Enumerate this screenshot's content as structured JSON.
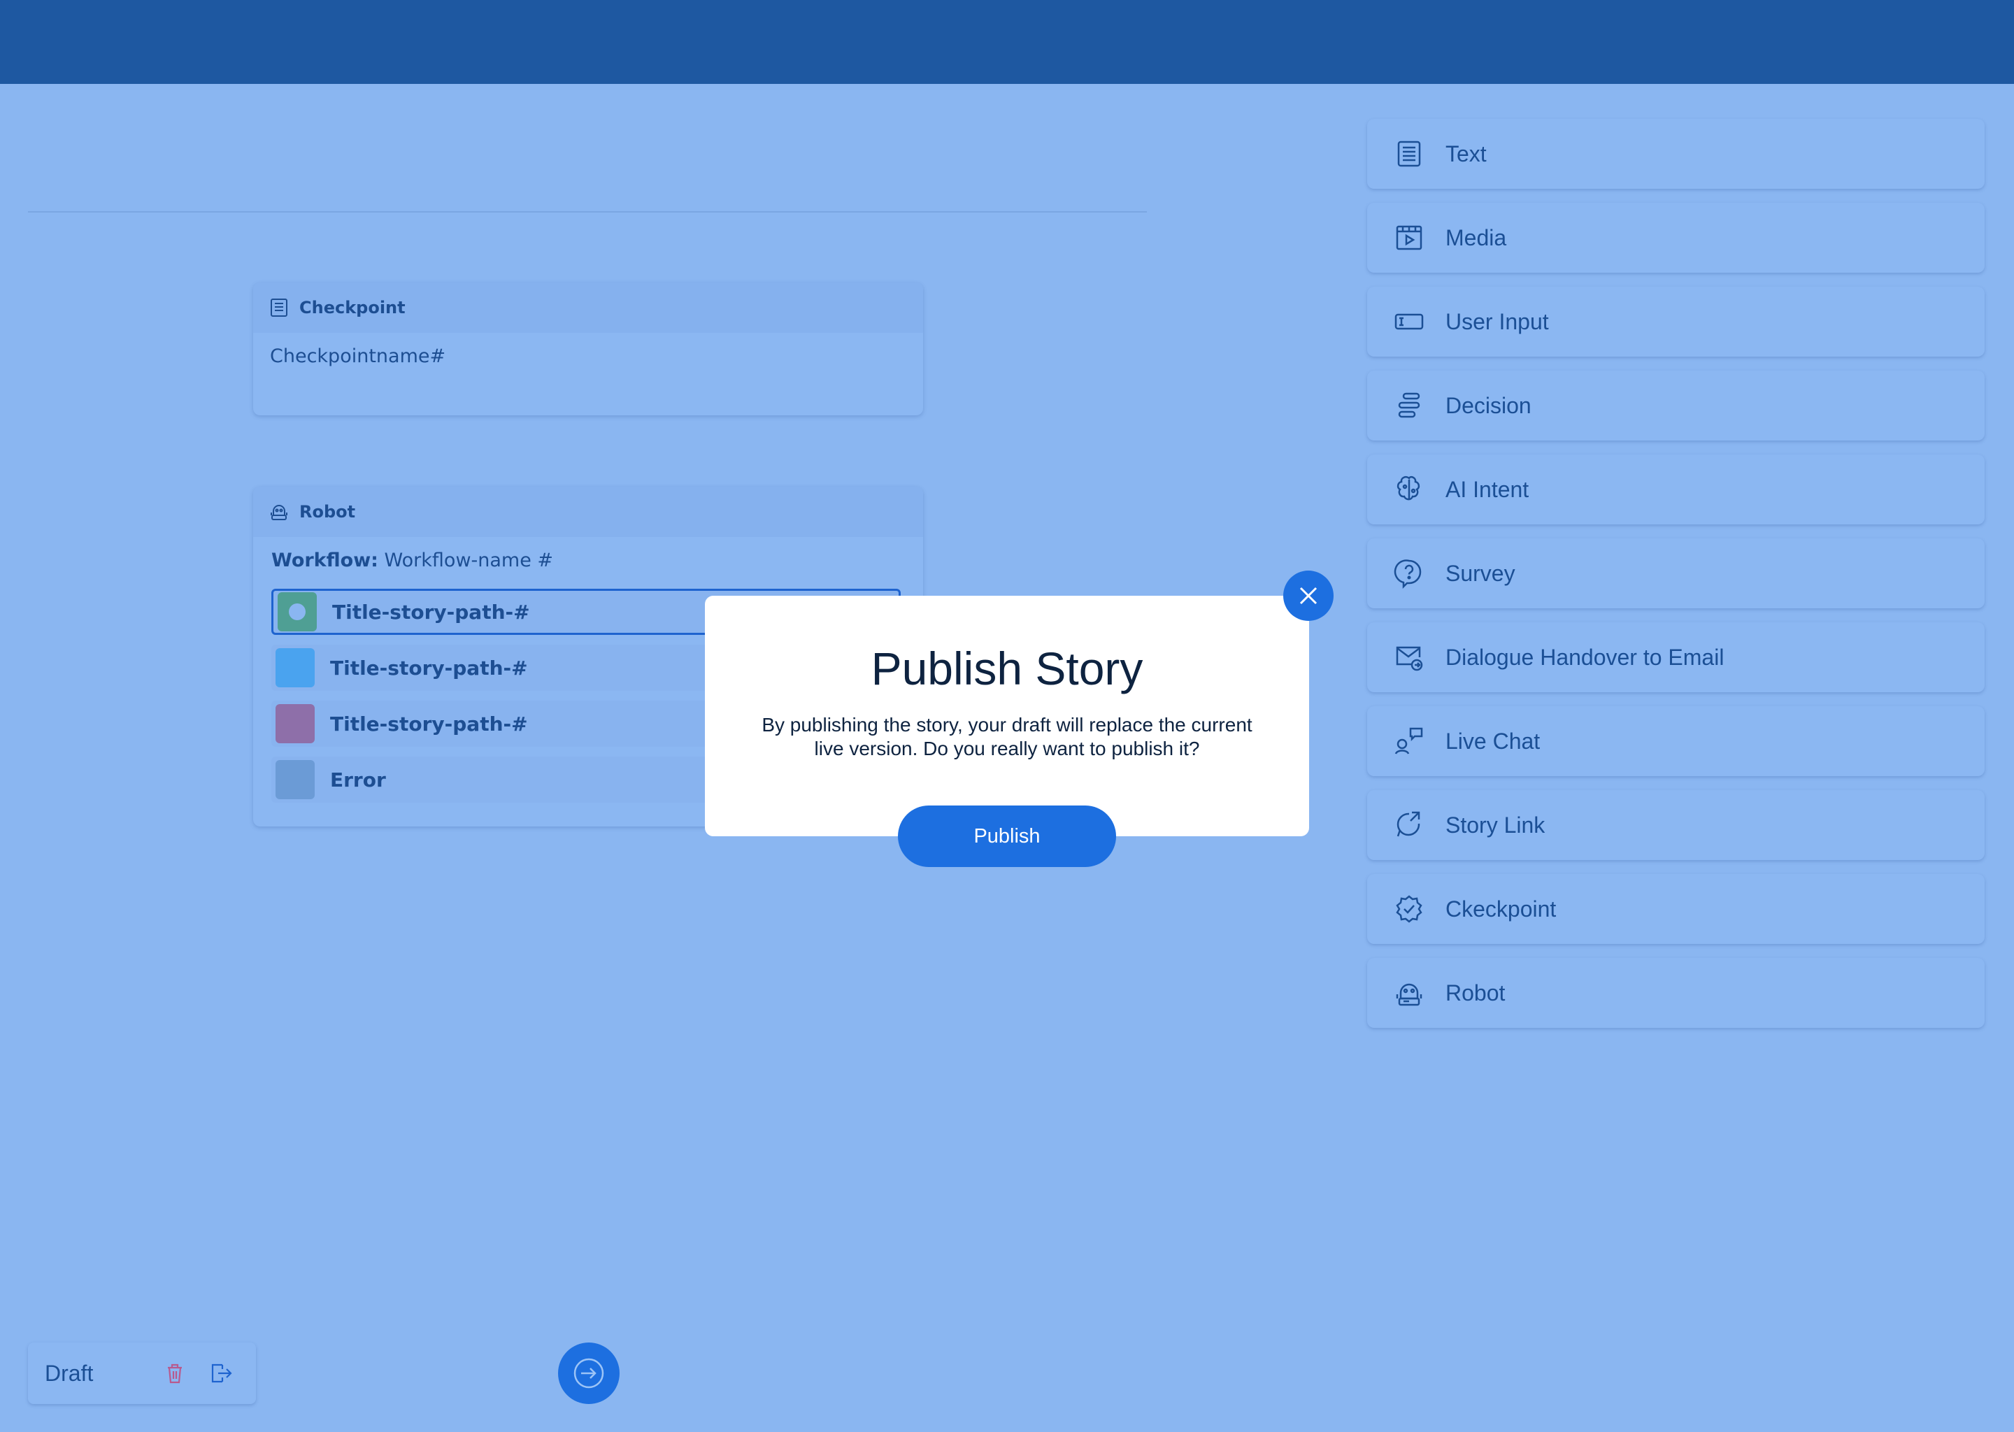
{
  "canvas": {
    "checkpoint_card": {
      "header_label": "Checkpoint",
      "name": "Checkpointname#"
    },
    "robot_card": {
      "header_label": "Robot",
      "workflow_label": "Workflow:",
      "workflow_name": "Workflow-name #",
      "paths": [
        {
          "label": "Title-story-path-#",
          "color": "#4f9f94",
          "selected": true
        },
        {
          "label": "Title-story-path-#",
          "color": "#4aa3ef",
          "selected": false
        },
        {
          "label": "Title-story-path-#",
          "color": "#8e6fa9",
          "selected": false
        },
        {
          "label": "Error",
          "color": "#6b9bd6",
          "selected": false
        }
      ]
    }
  },
  "palette": {
    "items": [
      {
        "label": "Text",
        "icon": "text-icon"
      },
      {
        "label": "Media",
        "icon": "media-icon"
      },
      {
        "label": "User Input",
        "icon": "user-input-icon"
      },
      {
        "label": "Decision",
        "icon": "decision-icon"
      },
      {
        "label": "AI Intent",
        "icon": "ai-intent-icon"
      },
      {
        "label": "Survey",
        "icon": "survey-icon"
      },
      {
        "label": "Dialogue Handover to Email",
        "icon": "email-handover-icon"
      },
      {
        "label": "Live Chat",
        "icon": "live-chat-icon"
      },
      {
        "label": "Story Link",
        "icon": "story-link-icon"
      },
      {
        "label": "Ckeckpoint",
        "icon": "checkpoint-icon"
      },
      {
        "label": "Robot",
        "icon": "robot-icon"
      }
    ]
  },
  "footer": {
    "status_label": "Draft",
    "delete_icon": "trash-icon",
    "exit_icon": "exit-icon",
    "next_icon": "arrow-right-circle-icon"
  },
  "modal": {
    "title": "Publish Story",
    "body": "By publishing the story, your draft will replace the current live version. Do you really want to publish it?",
    "publish_label": "Publish",
    "close_icon": "close-icon"
  },
  "colors": {
    "topbar": "#1e58a1",
    "background": "#8ab6f1",
    "accent": "#1d6fe0",
    "text": "#1b4f95"
  }
}
